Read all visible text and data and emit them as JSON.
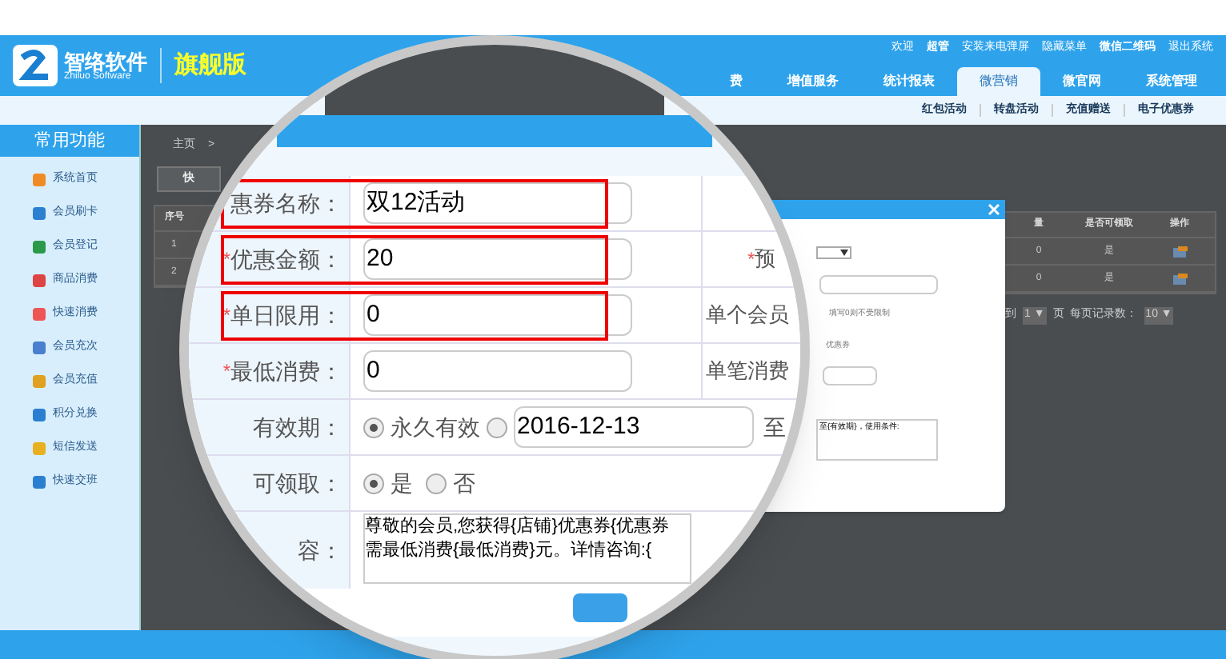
{
  "brand": {
    "name": "智络软件",
    "sub": "Zhiluo Software",
    "edition": "旗舰版"
  },
  "top_links": [
    {
      "text": "欢迎",
      "bold": false
    },
    {
      "text": "超管",
      "bold": true
    },
    {
      "text": "安装来电弹屏",
      "bold": false
    },
    {
      "text": "隐藏菜单",
      "bold": false
    },
    {
      "text": "微信二维码",
      "bold": true
    },
    {
      "text": "退出系统",
      "bold": false
    }
  ],
  "nav_tabs": [
    {
      "label": "费",
      "selected": false
    },
    {
      "label": "增值服务",
      "selected": false
    },
    {
      "label": "统计报表",
      "selected": false
    },
    {
      "label": "微营销",
      "selected": true
    },
    {
      "label": "微官网",
      "selected": false
    },
    {
      "label": "系统管理",
      "selected": false
    }
  ],
  "sub_nav": [
    "红包活动",
    "转盘活动",
    "充值赠送",
    "电子优惠券"
  ],
  "sidebar": {
    "title": "常用功能",
    "items": [
      "系统首页",
      "会员刷卡",
      "会员登记",
      "商品消费",
      "快速消费",
      "会员充次",
      "会员充值",
      "积分兑换",
      "短信发送",
      "快速交班"
    ]
  },
  "breadcrumb": [
    "主页",
    ">"
  ],
  "quick_button": "快",
  "left_table": {
    "header": "序号",
    "rows": [
      "1",
      "2"
    ]
  },
  "right_table": {
    "columns": [
      "量",
      "是否可领取",
      "操作"
    ],
    "rows": [
      [
        "0",
        "是"
      ],
      [
        "0",
        "是"
      ]
    ]
  },
  "pagination": {
    "before": "到",
    "page": "1 ▼",
    "after": "页  每页记录数：",
    "per_page": "10 ▼"
  },
  "modal": {
    "hint": "填写0则不受限制",
    "label": "优惠券",
    "template": "至{有效期}，使用条件:"
  },
  "magnified": {
    "rows": [
      {
        "label": "惠券名称：",
        "value": "双12活动",
        "highlighted": true
      },
      {
        "mark": "*",
        "label": "优惠金额：",
        "value": "20",
        "highlighted": true,
        "right_mark": "*",
        "right": "预"
      },
      {
        "mark": "*",
        "label": "单日限用：",
        "value": "0",
        "highlighted": true,
        "right": "单个会员"
      },
      {
        "mark": "*",
        "label": "最低消费：",
        "value": "0",
        "highlighted": false,
        "right": "单笔消费"
      }
    ],
    "validity": {
      "label": "有效期：",
      "options": [
        {
          "label": "永久有效",
          "selected": true
        },
        {
          "selected": false
        }
      ],
      "date": "2016-12-13",
      "to": "至"
    },
    "claimable": {
      "label": "可领取：",
      "options": [
        {
          "label": "是",
          "selected": true
        },
        {
          "label": "否",
          "selected": false
        }
      ]
    },
    "content": {
      "label": "容：",
      "lines": [
        "尊敬的会员,您获得{店铺}优惠券{优惠券",
        "需最低消费{最低消费}元。详情咨询:{"
      ]
    }
  }
}
